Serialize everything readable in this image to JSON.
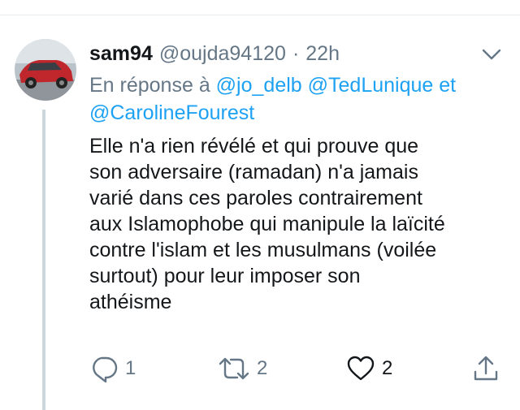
{
  "tweet": {
    "display_name": "sam94",
    "handle": "@oujda94120",
    "separator": "·",
    "time": "22h",
    "reply_prefix": "En réponse à",
    "mentions": [
      "@jo_delb",
      "@TedLunique",
      "@CarolineFourest"
    ],
    "mention_joiner": "et",
    "body_lines": [
      "Elle n'a rien révélé et qui prouve que",
      "son adversaire (ramadan) n'a jamais",
      "varié dans ces paroles contrairement",
      "aux Islamophobe qui manipule la laïcité",
      "contre l'islam et les musulmans (voilée",
      "surtout) pour leur imposer son",
      "athéisme"
    ]
  },
  "actions": {
    "reply": {
      "icon": "reply-icon",
      "count": "1"
    },
    "retweet": {
      "icon": "retweet-icon",
      "count": "2"
    },
    "like": {
      "icon": "heart-icon",
      "count": "2"
    },
    "share": {
      "icon": "share-icon"
    }
  },
  "colors": {
    "link": "#1da1f2",
    "muted": "#657786",
    "text": "#14171a",
    "thread_line": "#ccd6dd"
  }
}
